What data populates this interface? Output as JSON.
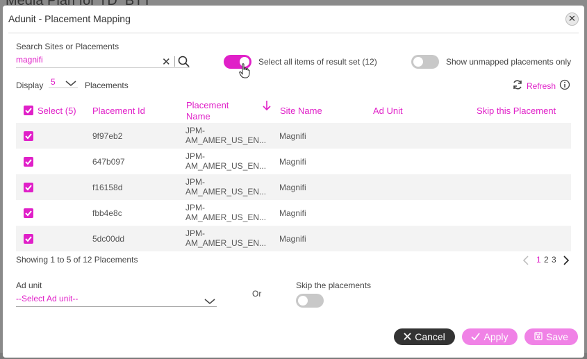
{
  "background": {
    "title": "Media Plan for TD_BTT"
  },
  "dialog": {
    "title": "Adunit - Placement Mapping",
    "close": "✕"
  },
  "search": {
    "label": "Search Sites or Placements",
    "value": "magnifi"
  },
  "select_all": {
    "label": "Select all items of result set (12)",
    "on": true
  },
  "show_unmapped": {
    "label": "Show unmapped placements only",
    "on": false
  },
  "display": {
    "label": "Display",
    "value": "5",
    "suffix": "Placements"
  },
  "refresh_label": "Refresh",
  "table": {
    "select_label": "Select (5)",
    "headers": {
      "placement_id": "Placement Id",
      "placement_name_1": "Placement",
      "placement_name_2": "Name",
      "site_name": "Site Name",
      "ad_unit": "Ad Unit",
      "skip": "Skip this Placement"
    },
    "rows": [
      {
        "id": "9f97eb2",
        "name_1": "JPM-",
        "name_2": "AM_AMER_US_EN...",
        "site": "Magnifi"
      },
      {
        "id": "647b097",
        "name_1": "JPM-",
        "name_2": "AM_AMER_US_EN...",
        "site": "Magnifi"
      },
      {
        "id": "f16158d",
        "name_1": "JPM-",
        "name_2": "AM_AMER_US_EN...",
        "site": "Magnifi"
      },
      {
        "id": "fbb4e8c",
        "name_1": "JPM-",
        "name_2": "AM_AMER_US_EN...",
        "site": "Magnifi"
      },
      {
        "id": "5dc00dd",
        "name_1": "JPM-",
        "name_2": "AM_AMER_US_EN...",
        "site": "Magnifi"
      }
    ]
  },
  "showing": "Showing 1 to 5 of 12 Placements",
  "pagination": {
    "pages": [
      "1",
      "2",
      "3"
    ],
    "current": "1"
  },
  "ad_unit": {
    "label": "Ad unit",
    "value": "--Select Ad unit--"
  },
  "or_label": "Or",
  "skip_placements": {
    "label": "Skip the placements",
    "on": false
  },
  "buttons": {
    "cancel": "Cancel",
    "apply": "Apply",
    "save": "Save"
  },
  "colors": {
    "accent": "#e020c8",
    "accent_light": "#f082e6",
    "dark": "#333333"
  }
}
